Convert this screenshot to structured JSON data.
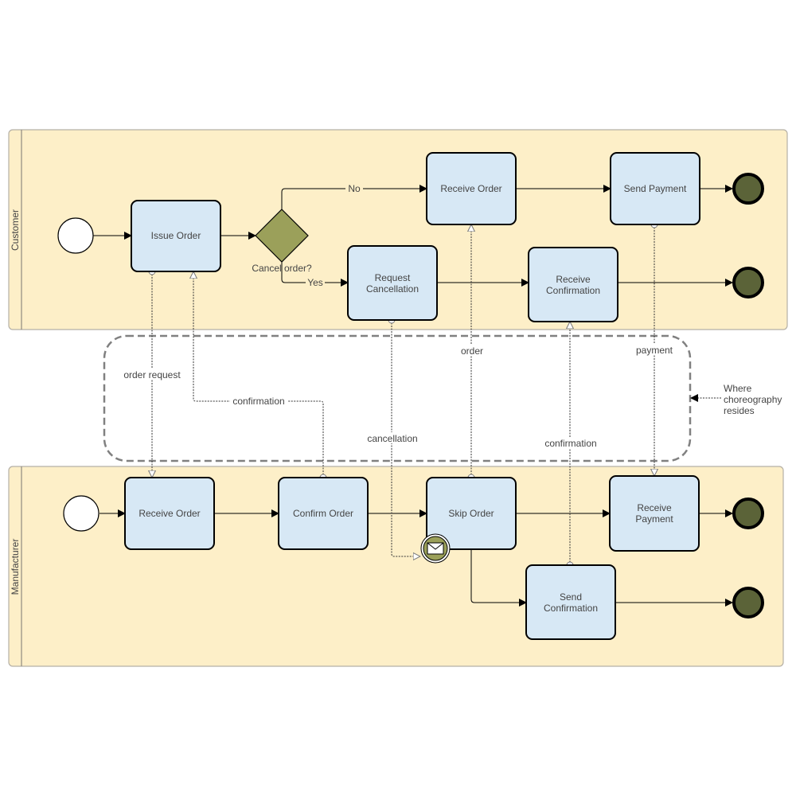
{
  "diagram": {
    "type": "BPMN collaboration",
    "pools": [
      {
        "id": "customer",
        "label": "Customer"
      },
      {
        "id": "manufacturer",
        "label": "Manufacturer"
      }
    ],
    "customer": {
      "tasks": {
        "issue_order": "Issue Order",
        "receive_order": "Receive Order",
        "send_payment": "Send Payment",
        "request_cancellation_1": "Request",
        "request_cancellation_2": "Cancellation",
        "receive_confirmation_1": "Receive",
        "receive_confirmation_2": "Confirmation"
      },
      "gateway": {
        "label": "Cancel order?",
        "no_label": "No",
        "yes_label": "Yes"
      }
    },
    "manufacturer": {
      "tasks": {
        "receive_order": "Receive Order",
        "confirm_order": "Confirm Order",
        "skip_order": "Skip Order",
        "receive_payment_1": "Receive",
        "receive_payment_2": "Payment",
        "send_confirmation_1": "Send",
        "send_confirmation_2": "Confirmation"
      }
    },
    "messages": {
      "order_request": "order request",
      "confirmation_1": "confirmation",
      "cancellation": "cancellation",
      "order": "order",
      "confirmation_2": "confirmation",
      "payment": "payment"
    },
    "annotation": {
      "line1": "Where",
      "line2": "choreography",
      "line3": "resides"
    },
    "colors": {
      "pool_fill": "#fdefc8",
      "task_fill": "#d7e8f5",
      "gateway_fill": "#9ba05a",
      "end_event_fill": "#5b6338",
      "choreography_border": "#808080"
    }
  }
}
